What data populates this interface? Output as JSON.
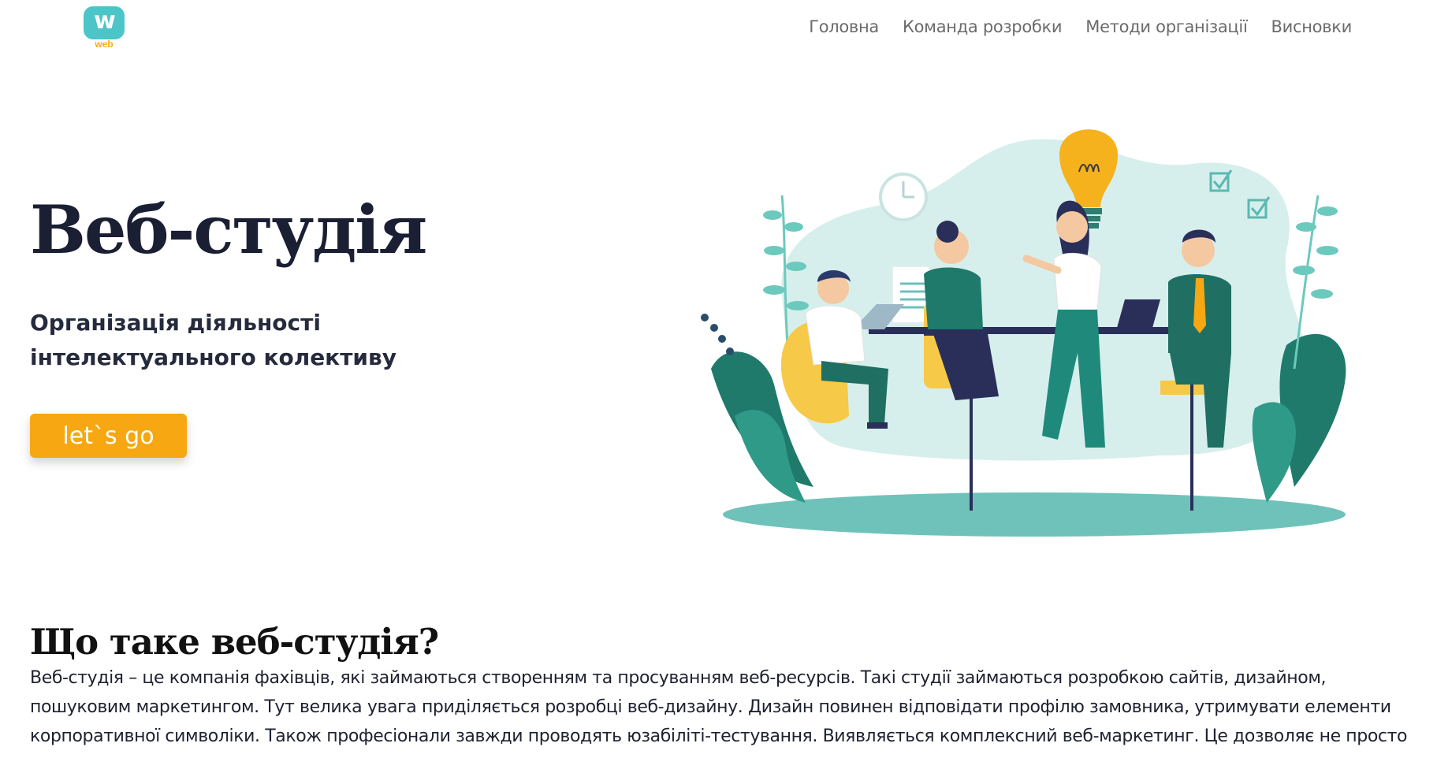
{
  "header": {
    "logo": {
      "glyph": "w",
      "word": "web"
    },
    "nav": [
      {
        "label": "Головна"
      },
      {
        "label": "Команда розробки"
      },
      {
        "label": "Методи організації"
      },
      {
        "label": "Висновки"
      }
    ]
  },
  "hero": {
    "title": "Веб-студія",
    "subtitle_line1": "Організація діяльності",
    "subtitle_line2": "інтелектуального колективу",
    "cta_label": "let`s go",
    "illustration": "team-meeting-illustration"
  },
  "intro": {
    "title": "Що таке веб-студія?",
    "body": "Веб-студія – це компанія фахівців, які займаються створенням та просуванням веб-ресурсів. Такі студії займаються розробкою сайтів, дизайном, пошуковим маркетингом. Тут велика увага приділяється розробці веб-дизайну. Дизайн повинен відповідати профілю замовника, утримувати елементи корпоративної символіки. Також професіонали завжди проводять юзабіліті-тестування. Виявляється комплексний веб-маркетинг. Це дозволяє не просто"
  },
  "colors": {
    "accent": "#f6a711",
    "logo": "#4cc5c8",
    "teal": "#1e8a7c",
    "nav_text": "#6b6b6b",
    "heading": "#1b1f33"
  }
}
